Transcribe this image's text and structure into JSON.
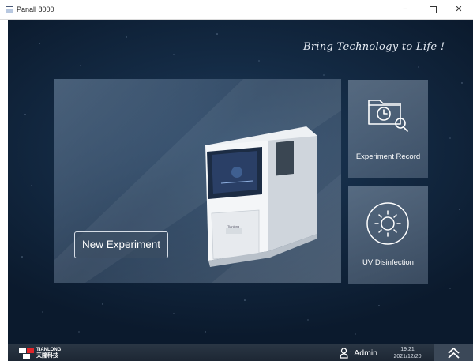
{
  "window": {
    "title": "Panall 8000",
    "minimize_glyph": "−",
    "close_glyph": "✕"
  },
  "header": {
    "tagline": "Bring Technology to Life !"
  },
  "main": {
    "new_experiment_label": "New Experiment",
    "device_badge": "Tianlong",
    "tiles": {
      "record_label": "Experiment Record",
      "uv_label": "UV Disinfection"
    }
  },
  "footer": {
    "logo_en": "TIANLONG",
    "logo_cn": "天隆科技",
    "user_label": ": Admin",
    "time": "19:21",
    "date": "2021/12/20"
  },
  "icons": {
    "app": "app-window-icon",
    "record": "folder-clock-search-icon",
    "uv": "sun-icon",
    "user": "user-icon",
    "scroll_up": "double-chevron-up-icon"
  },
  "colors": {
    "background": "#142b45",
    "panel": "#6f87a0",
    "statusbar": "#1d2734",
    "logo_red": "#e0262b"
  }
}
